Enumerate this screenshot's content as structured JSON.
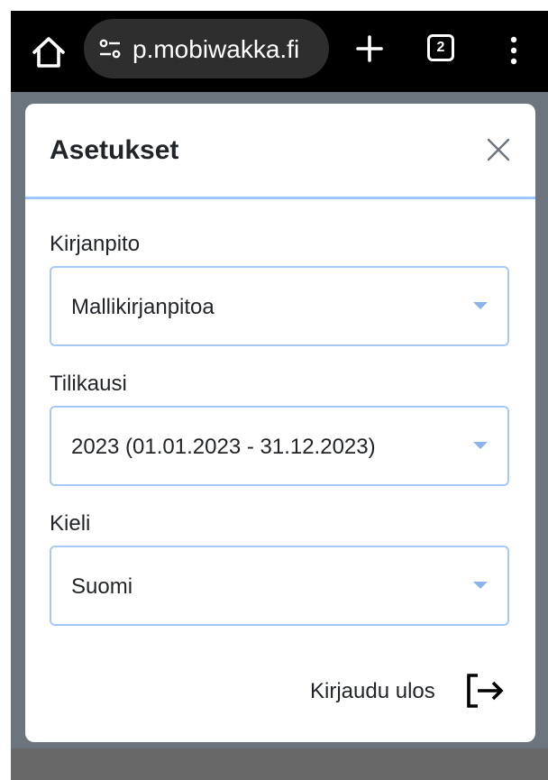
{
  "browser": {
    "url": "p.mobiwakka.fi",
    "tab_count": "2",
    "icons": {
      "home": "home-icon",
      "site_settings": "site-settings-icon",
      "new_tab": "plus-icon",
      "tabs": "tab-switcher-icon",
      "menu": "more-vert-icon"
    }
  },
  "modal": {
    "title": "Asetukset",
    "close_icon": "close-icon",
    "fields": [
      {
        "label": "Kirjanpito",
        "value": "Mallikirjanpitoa"
      },
      {
        "label": "Tilikausi",
        "value": "2023 (01.01.2023 - 31.12.2023)"
      },
      {
        "label": "Kieli",
        "value": "Suomi"
      }
    ],
    "logout_label": "Kirjaudu ulos",
    "logout_icon": "logout-icon"
  },
  "colors": {
    "header_border": "#9ec5fe",
    "select_border": "#a8c8f5",
    "caret": "#8cb4ea",
    "backdrop": "#6c757d"
  }
}
